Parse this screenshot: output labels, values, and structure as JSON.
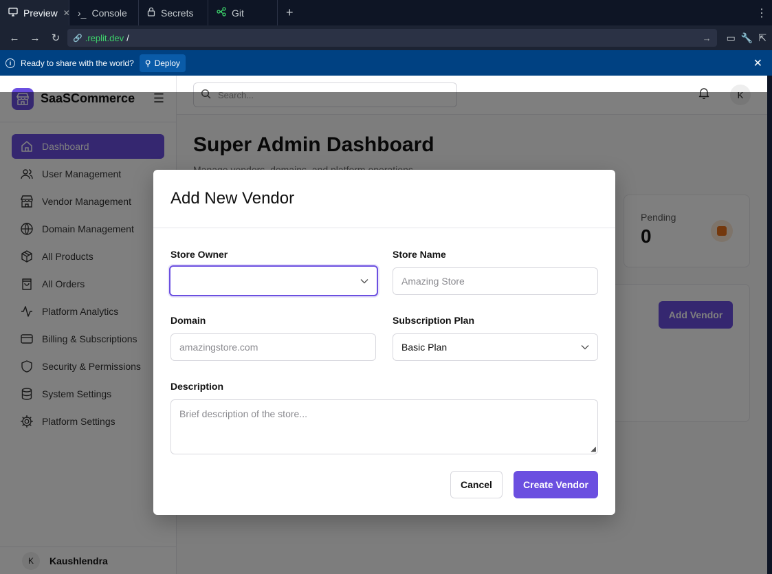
{
  "browser": {
    "tabs": [
      {
        "label": "Preview",
        "icon": "monitor-icon",
        "active": true
      },
      {
        "label": "Console",
        "icon": "terminal-icon"
      },
      {
        "label": "Secrets",
        "icon": "lock-icon"
      },
      {
        "label": "Git",
        "icon": "git-icon"
      }
    ],
    "url_domain": ".replit.dev",
    "url_path": "/",
    "banner_text": "Ready to share with the world?",
    "deploy_label": "Deploy"
  },
  "app": {
    "brand": "SaaSCommerce",
    "search_placeholder": "Search...",
    "avatar_initial": "K",
    "nav": [
      {
        "label": "Dashboard",
        "icon": "home-icon",
        "active": true
      },
      {
        "label": "User Management",
        "icon": "users-icon"
      },
      {
        "label": "Vendor Management",
        "icon": "store-icon"
      },
      {
        "label": "Domain Management",
        "icon": "globe-icon"
      },
      {
        "label": "All Products",
        "icon": "package-icon"
      },
      {
        "label": "All Orders",
        "icon": "shopping-bag-icon"
      },
      {
        "label": "Platform Analytics",
        "icon": "activity-icon"
      },
      {
        "label": "Billing & Subscriptions",
        "icon": "credit-card-icon"
      },
      {
        "label": "Security & Permissions",
        "icon": "shield-icon"
      },
      {
        "label": "System Settings",
        "icon": "database-icon"
      },
      {
        "label": "Platform Settings",
        "icon": "gear-icon"
      }
    ],
    "user": {
      "initial": "K",
      "name": "Kaushlendra"
    },
    "page_title": "Super Admin Dashboard",
    "page_subtitle": "Manage vendors, domains, and platform operations",
    "pending": {
      "label": "Pending",
      "value": "0"
    },
    "add_vendor_label": "Add Vendor"
  },
  "modal": {
    "title": "Add New Vendor",
    "store_owner_label": "Store Owner",
    "store_owner_value": "",
    "store_name_label": "Store Name",
    "store_name_placeholder": "Amazing Store",
    "domain_label": "Domain",
    "domain_placeholder": "amazingstore.com",
    "plan_label": "Subscription Plan",
    "plan_value": "Basic Plan",
    "description_label": "Description",
    "description_placeholder": "Brief description of the store...",
    "cancel_label": "Cancel",
    "create_label": "Create Vendor"
  },
  "colors": {
    "accent": "#6b4fe0",
    "banner": "#004182",
    "pending_icon": "#e8701a"
  }
}
